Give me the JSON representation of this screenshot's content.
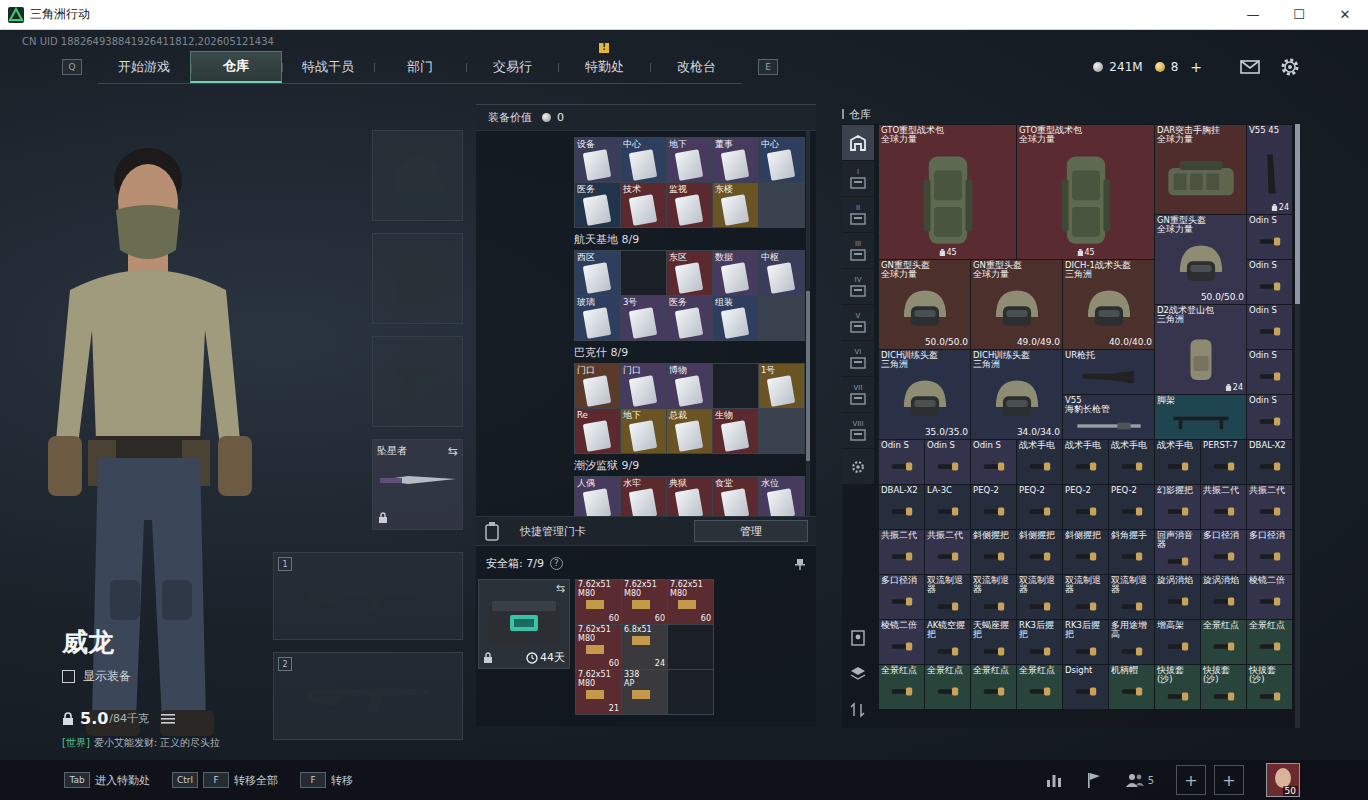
{
  "window": {
    "title": "三角洲行动",
    "controls": [
      "—",
      "☐",
      "✕"
    ]
  },
  "uid": "CN UID 188264938841926411812,202605121434",
  "nav": {
    "left_key": "Q",
    "right_key": "E",
    "alert_mark": "!",
    "tabs": [
      {
        "label": "开始游戏",
        "selected": false,
        "alert": false
      },
      {
        "label": "仓库",
        "selected": true,
        "alert": false
      },
      {
        "label": "特战干员",
        "selected": false,
        "alert": false
      },
      {
        "label": "部门",
        "selected": false,
        "alert": false
      },
      {
        "label": "交易行",
        "selected": false,
        "alert": false
      },
      {
        "label": "特勤处",
        "selected": false,
        "alert": true
      },
      {
        "label": "改枪台",
        "selected": false,
        "alert": false
      }
    ]
  },
  "wallet": {
    "coins": "241M",
    "gold": "8",
    "add": "+"
  },
  "operator": {
    "name": "威龙",
    "show_gear": {
      "label": "显示装备",
      "checked": false
    },
    "weight": "5.0",
    "capacity": "/84千克",
    "chat_channel": "[世界]",
    "chat_text": "爱小艾能发财: 正义的尽头拉"
  },
  "gear_slots": [
    {
      "kind": "helmet",
      "locked": false
    },
    {
      "kind": "armor",
      "locked": false
    },
    {
      "kind": "pistol",
      "locked": false
    },
    {
      "kind": "melee",
      "label": "坠星者",
      "swap": "⇆",
      "locked": true
    }
  ],
  "weapon_slots": [
    {
      "number": "1"
    },
    {
      "number": "2"
    }
  ],
  "loadout": {
    "title": "装备价值",
    "value": "0",
    "keycard_sections": [
      {
        "title": null,
        "count": null,
        "cards": [
          {
            "kind": "card",
            "label": "设备",
            "color": "#3a3d5a"
          },
          {
            "kind": "card",
            "label": "中心",
            "color": "#2e3e5e"
          },
          {
            "kind": "card",
            "label": "地下",
            "color": "#463a5e"
          },
          {
            "kind": "card",
            "label": "董事",
            "color": "#463a5e"
          },
          {
            "kind": "card",
            "label": "中心",
            "color": "#2e3e5e"
          },
          {
            "kind": "card",
            "label": "医务",
            "color": "#223449"
          },
          {
            "kind": "card",
            "label": "技术",
            "color": "#5c2a2e"
          },
          {
            "kind": "card",
            "label": "监视",
            "color": "#5c2a2e"
          },
          {
            "kind": "card",
            "label": "东楼",
            "color": "#6a5424"
          }
        ]
      },
      {
        "title": "航天基地",
        "count": "8/9",
        "cards": [
          {
            "kind": "card",
            "label": "西区",
            "color": "#2e3e5e"
          },
          {
            "kind": "empty"
          },
          {
            "kind": "card",
            "label": "东区",
            "color": "#5c2a2e"
          },
          {
            "kind": "card",
            "label": "数据",
            "color": "#463a5e"
          },
          {
            "kind": "card",
            "label": "中枢",
            "color": "#3a3d5a"
          },
          {
            "kind": "card",
            "label": "玻璃",
            "color": "#2e3e5e"
          },
          {
            "kind": "card",
            "label": "3号",
            "color": "#463a5e"
          },
          {
            "kind": "card",
            "label": "医务",
            "color": "#463a5e"
          },
          {
            "kind": "card",
            "label": "组装",
            "color": "#2e3e5e"
          }
        ]
      },
      {
        "title": "巴克什",
        "count": "8/9",
        "cards": [
          {
            "kind": "card",
            "label": "门口",
            "color": "#5a3a2a"
          },
          {
            "kind": "card",
            "label": "门口",
            "color": "#463a5e"
          },
          {
            "kind": "card",
            "label": "博物",
            "color": "#463a5e"
          },
          {
            "kind": "empty"
          },
          {
            "kind": "card",
            "label": "1号",
            "color": "#6a5424"
          },
          {
            "kind": "card",
            "label": "Re",
            "color": "#5c2a2e"
          },
          {
            "kind": "card",
            "label": "地下",
            "color": "#6a5424"
          },
          {
            "kind": "card",
            "label": "总裁",
            "color": "#6a5424"
          },
          {
            "kind": "card",
            "label": "生物",
            "color": "#5c2a2e"
          }
        ]
      },
      {
        "title": "潮汐监狱",
        "count": "9/9",
        "cards": [
          {
            "kind": "card",
            "label": "人偶",
            "color": "#463a5e"
          },
          {
            "kind": "card",
            "label": "水牢",
            "color": "#5c2a2e"
          },
          {
            "kind": "card",
            "label": "典狱",
            "color": "#5c2a2e"
          },
          {
            "kind": "card",
            "label": "食堂",
            "color": "#5c2a2e"
          },
          {
            "kind": "card",
            "label": "水位",
            "color": "#463a5e"
          }
        ]
      }
    ],
    "quick_card": {
      "label": "快捷管理门卡",
      "button": "管理"
    },
    "safe": {
      "title": "安全箱: 7/9",
      "help": "?",
      "days": "44天",
      "swap": "⇆",
      "locked": true,
      "items": [
        {
          "kind": "ammo",
          "name": "7.62x51",
          "sub": "M80",
          "count": "60",
          "color": "#5a2b30"
        },
        {
          "kind": "ammo",
          "name": "7.62x51",
          "sub": "M80",
          "count": "60",
          "color": "#5a2b30"
        },
        {
          "kind": "ammo",
          "name": "7.62x51",
          "sub": "M80",
          "count": "60",
          "color": "#5a2b30"
        },
        {
          "kind": "ammo",
          "name": "7.62x51",
          "sub": "M80",
          "count": "60",
          "color": "#5a2b30"
        },
        {
          "kind": "ammo",
          "name": "6.8x51",
          "sub": "",
          "count": "24",
          "color": "#3a3a3e"
        },
        {
          "kind": "empty"
        },
        {
          "kind": "ammo",
          "name": "7.62x51",
          "sub": "M80",
          "count": "21",
          "color": "#5a2b30"
        },
        {
          "kind": "ammo",
          "name": "338",
          "sub": "AP",
          "count": "",
          "color": "#3a3a3e"
        },
        {
          "kind": "empty"
        }
      ]
    }
  },
  "warehouse": {
    "title": "仓库",
    "tabs": [
      {
        "kind": "home",
        "label": "",
        "selected": true
      },
      {
        "kind": "page",
        "label": "I",
        "selected": false
      },
      {
        "kind": "page",
        "label": "II",
        "selected": false
      },
      {
        "kind": "page",
        "label": "III",
        "selected": false
      },
      {
        "kind": "page",
        "label": "IV",
        "selected": false
      },
      {
        "kind": "page",
        "label": "V",
        "selected": false
      },
      {
        "kind": "page",
        "label": "VI",
        "selected": false
      },
      {
        "kind": "page",
        "label": "VII",
        "selected": false
      },
      {
        "kind": "page",
        "label": "VIII",
        "selected": false
      },
      {
        "kind": "settings",
        "label": "",
        "selected": false
      }
    ],
    "items": [
      {
        "name": "GTO重型战术包",
        "sub": "全球力量",
        "kind": "pack-large",
        "color": "#5a2b30",
        "count": "45"
      },
      {
        "name": "GTO重型战术包",
        "sub": "全球力量",
        "kind": "pack-large",
        "color": "#5a2b30",
        "count": "45"
      },
      {
        "name": "DAR突击手胸挂",
        "sub": "全球力量",
        "kind": "vest",
        "color": "#4f2d2d"
      },
      {
        "name": "V55 45",
        "kind": "mag",
        "color": "#33324a",
        "count": "24"
      },
      {
        "name": "GN重型头盔",
        "sub": "全球力量",
        "kind": "helmet",
        "color": "#36354d",
        "durability": "50.0/50.0"
      },
      {
        "name": "Odin S",
        "kind": "attachment",
        "color": "#33334c"
      },
      {
        "name": "GN重型头盔",
        "sub": "全球力量",
        "kind": "helmet",
        "color": "#4c302b",
        "durability": "50.0/50.0"
      },
      {
        "name": "GN重型头盔",
        "sub": "全球力量",
        "kind": "helmet",
        "color": "#4c302b",
        "durability": "49.0/49.0"
      },
      {
        "name": "DICH-1战术头盔",
        "sub": "三角洲",
        "kind": "helmet",
        "color": "#4c302b",
        "durability": "40.0/40.0"
      },
      {
        "name": "Odin S",
        "kind": "attachment",
        "color": "#33334c"
      },
      {
        "name": "D2战术登山包",
        "sub": "三角洲",
        "kind": "pack",
        "color": "#36354d",
        "count": "24"
      },
      {
        "name": "Odin S",
        "kind": "attachment",
        "color": "#33334c"
      },
      {
        "name": "DICH训练头盔",
        "sub": "三角洲",
        "kind": "helmet",
        "color": "#2a3147",
        "durability": "35.0/35.0"
      },
      {
        "name": "DICH训练头盔",
        "sub": "三角洲",
        "kind": "helmet",
        "color": "#2a3147",
        "durability": "34.0/34.0"
      },
      {
        "name": "UR枪托",
        "kind": "stock",
        "color": "#2a3147"
      },
      {
        "name": "Odin S",
        "kind": "attachment",
        "color": "#33334c"
      },
      {
        "name": "V55",
        "sub": "海豹长枪管",
        "kind": "barrel",
        "color": "#2a3147"
      },
      {
        "name": "脚架",
        "kind": "tripod",
        "color": "#1f4550"
      },
      {
        "name": "Odin S",
        "kind": "attachment",
        "color": "#33334c"
      },
      {
        "name": "Odin S",
        "kind": "attachment",
        "color": "#33334c"
      },
      {
        "name": "Odin S",
        "kind": "attachment",
        "color": "#33334c"
      },
      {
        "name": "Odin S",
        "kind": "attachment",
        "color": "#33334c"
      },
      {
        "name": "战术手电",
        "kind": "attachment",
        "color": "#262d3d"
      },
      {
        "name": "战术手电",
        "kind": "attachment",
        "color": "#262d3d"
      },
      {
        "name": "战术手电",
        "kind": "attachment",
        "color": "#262d3d"
      },
      {
        "name": "战术手电",
        "kind": "attachment",
        "color": "#262d3d"
      },
      {
        "name": "PERST-7",
        "kind": "attachment",
        "color": "#262d3d"
      },
      {
        "name": "DBAL-X2",
        "kind": "attachment",
        "color": "#262d3d"
      },
      {
        "name": "DBAL-X2",
        "kind": "attachment",
        "color": "#262d3d"
      },
      {
        "name": "LA-3C",
        "kind": "attachment",
        "color": "#262d3d"
      },
      {
        "name": "PEQ-2",
        "kind": "attachment",
        "color": "#262d3d"
      },
      {
        "name": "PEQ-2",
        "kind": "attachment",
        "color": "#262d3d"
      },
      {
        "name": "PEQ-2",
        "kind": "attachment",
        "color": "#262d3d"
      },
      {
        "name": "PEQ-2",
        "kind": "attachment",
        "color": "#262d3d"
      },
      {
        "name": "幻影握把",
        "kind": "attachment",
        "color": "#33334c"
      },
      {
        "name": "共振二代",
        "kind": "attachment",
        "color": "#33334c"
      },
      {
        "name": "共振二代",
        "kind": "attachment",
        "color": "#33334c"
      },
      {
        "name": "共振二代",
        "kind": "attachment",
        "color": "#33334c"
      },
      {
        "name": "共振二代",
        "kind": "attachment",
        "color": "#33334c"
      },
      {
        "name": "斜侧握把",
        "kind": "attachment",
        "color": "#262d3d"
      },
      {
        "name": "斜侧握把",
        "kind": "attachment",
        "color": "#262d3d"
      },
      {
        "name": "斜侧握把",
        "kind": "attachment",
        "color": "#262d3d"
      },
      {
        "name": "斜角握手",
        "kind": "attachment",
        "color": "#262d3d"
      },
      {
        "name": "回声消音器",
        "kind": "attachment",
        "color": "#33334c"
      },
      {
        "name": "多口径消",
        "kind": "attachment",
        "color": "#33334c"
      },
      {
        "name": "多口径消",
        "kind": "attachment",
        "color": "#33334c"
      },
      {
        "name": "多口径消",
        "kind": "attachment",
        "color": "#33334c"
      },
      {
        "name": "双流制退器",
        "kind": "attachment",
        "color": "#262d3d"
      },
      {
        "name": "双流制退器",
        "kind": "attachment",
        "color": "#262d3d"
      },
      {
        "name": "双流制退器",
        "kind": "attachment",
        "color": "#262d3d"
      },
      {
        "name": "双流制退器",
        "kind": "attachment",
        "color": "#262d3d"
      },
      {
        "name": "双流制退器",
        "kind": "attachment",
        "color": "#262d3d"
      },
      {
        "name": "旋涡消焰",
        "kind": "attachment",
        "color": "#262d3d"
      },
      {
        "name": "旋涡消焰",
        "kind": "attachment",
        "color": "#262d3d"
      },
      {
        "name": "棱镜二倍",
        "kind": "attachment",
        "color": "#33334c"
      },
      {
        "name": "棱镜二倍",
        "kind": "attachment",
        "color": "#33334c"
      },
      {
        "name": "AK镜空握把",
        "kind": "attachment",
        "color": "#262d3d"
      },
      {
        "name": "天蝎座握把",
        "kind": "attachment",
        "color": "#262d3d"
      },
      {
        "name": "RK3后握把",
        "kind": "attachment",
        "color": "#262d3d"
      },
      {
        "name": "RK3后握把",
        "kind": "attachment",
        "color": "#262d3d"
      },
      {
        "name": "多用途增高",
        "kind": "attachment",
        "color": "#262d3d"
      },
      {
        "name": "增高架",
        "kind": "attachment",
        "color": "#262d3d"
      },
      {
        "name": "全景红点",
        "kind": "attachment",
        "color": "#29453b"
      },
      {
        "name": "全景红点",
        "kind": "attachment",
        "color": "#29453b"
      },
      {
        "name": "全景红点",
        "kind": "attachment",
        "color": "#29453b"
      },
      {
        "name": "全景红点",
        "kind": "attachment",
        "color": "#29453b"
      },
      {
        "name": "全景红点",
        "kind": "attachment",
        "color": "#29453b"
      },
      {
        "name": "全景红点",
        "kind": "attachment",
        "color": "#29453b"
      },
      {
        "name": "Dsight",
        "kind": "attachment",
        "color": "#262d3d"
      },
      {
        "name": "机柄帽",
        "kind": "attachment",
        "color": "#29453b"
      },
      {
        "name": "快拔套(沙)",
        "kind": "attachment",
        "color": "#29453b"
      },
      {
        "name": "快拔套(沙)",
        "kind": "attachment",
        "color": "#29453b"
      },
      {
        "name": "快拔套(沙)",
        "kind": "attachment",
        "color": "#29453b"
      }
    ]
  },
  "bottom": {
    "hints": [
      {
        "keys": [
          "Tab"
        ],
        "label": "进入特勤处"
      },
      {
        "keys": [
          "Ctrl",
          "F"
        ],
        "label": "转移全部"
      },
      {
        "keys": [
          "F"
        ],
        "label": "转移"
      }
    ],
    "party": "5",
    "add": "+",
    "level": "50"
  }
}
